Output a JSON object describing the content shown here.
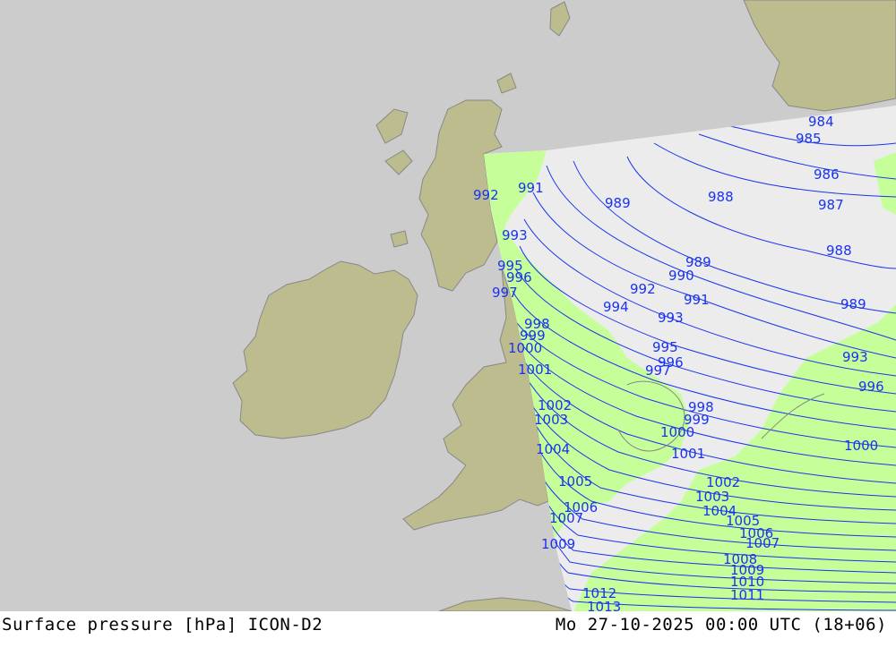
{
  "footer": {
    "left": "Surface pressure [hPa] ICON-D2",
    "right": "Mo 27-10-2025 00:00 UTC (18+06)"
  },
  "colors": {
    "sea": "#cccccc",
    "land": "#bdbc8e",
    "coast": "#888888",
    "domain_sea": "#ececec",
    "domain_land": "#c6ff9a",
    "isobar": "#1a33ee"
  },
  "isobar_labels": [
    {
      "text": "984"
    },
    {
      "text": "985"
    },
    {
      "text": "986"
    },
    {
      "text": "987"
    },
    {
      "text": "988"
    },
    {
      "text": "988"
    },
    {
      "text": "989"
    },
    {
      "text": "989"
    },
    {
      "text": "989"
    },
    {
      "text": "990"
    },
    {
      "text": "991"
    },
    {
      "text": "991"
    },
    {
      "text": "992"
    },
    {
      "text": "992"
    },
    {
      "text": "993"
    },
    {
      "text": "993"
    },
    {
      "text": "993"
    },
    {
      "text": "994"
    },
    {
      "text": "995"
    },
    {
      "text": "995"
    },
    {
      "text": "996"
    },
    {
      "text": "996"
    },
    {
      "text": "996"
    },
    {
      "text": "997"
    },
    {
      "text": "997"
    },
    {
      "text": "998"
    },
    {
      "text": "998"
    },
    {
      "text": "999"
    },
    {
      "text": "999"
    },
    {
      "text": "1000"
    },
    {
      "text": "1000"
    },
    {
      "text": "1000"
    },
    {
      "text": "1001"
    },
    {
      "text": "1001"
    },
    {
      "text": "1002"
    },
    {
      "text": "1002"
    },
    {
      "text": "1003"
    },
    {
      "text": "1003"
    },
    {
      "text": "1004"
    },
    {
      "text": "1004"
    },
    {
      "text": "1005"
    },
    {
      "text": "1005"
    },
    {
      "text": "1006"
    },
    {
      "text": "1006"
    },
    {
      "text": "1007"
    },
    {
      "text": "1007"
    },
    {
      "text": "1008"
    },
    {
      "text": "1009"
    },
    {
      "text": "1009"
    },
    {
      "text": "1010"
    },
    {
      "text": "1011"
    },
    {
      "text": "1012"
    },
    {
      "text": "1013"
    }
  ]
}
